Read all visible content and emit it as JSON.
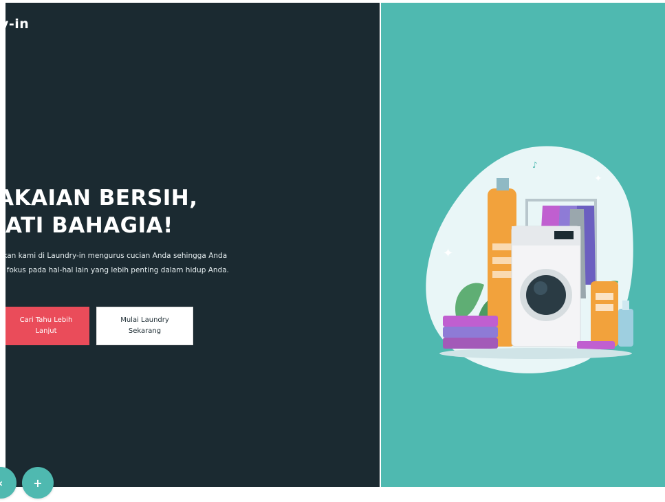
{
  "brand": {
    "name": "y-in"
  },
  "hero": {
    "headline_line1": "AKAIAN BERSIH,",
    "headline_line2": "IATI BAHAGIA!",
    "description_line1": "rkan kami di Laundry-in mengurus cucian Anda sehingga Anda",
    "description_line2": "a fokus pada hal-hal lain yang lebih penting dalam hidup Anda.",
    "primary_button": "Cari Tahu Lebih Lanjut",
    "secondary_button": "Mulai Laundry Sekarang"
  },
  "nav": {
    "prev_icon": "‹",
    "next_icon": "+"
  },
  "colors": {
    "left_panel": "#1b2a31",
    "right_panel": "#4fb9b0",
    "primary_button": "#ea4c5a",
    "accent": "#4fb9b0"
  },
  "illustration": {
    "icon": "laundry-illustration"
  }
}
